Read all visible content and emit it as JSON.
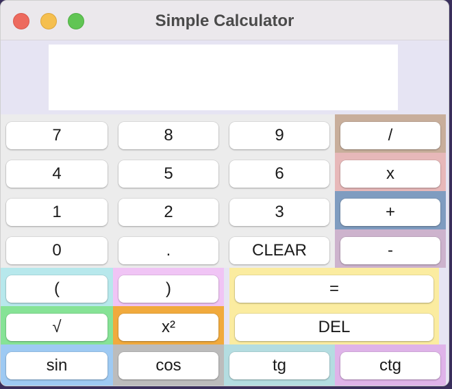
{
  "window": {
    "title": "Simple Calculator"
  },
  "display": {
    "value": ""
  },
  "buttons": {
    "seven": "7",
    "eight": "8",
    "nine": "9",
    "divide": "/",
    "four": "4",
    "five": "5",
    "six": "6",
    "multiply": "x",
    "one": "1",
    "two": "2",
    "three": "3",
    "plus": "+",
    "zero": "0",
    "dot": ".",
    "clear": "CLEAR",
    "minus": "-",
    "lparen": "(",
    "rparen": ")",
    "equals": "=",
    "sqrt": "√",
    "square": "x²",
    "del": "DEL",
    "sin": "sin",
    "cos": "cos",
    "tg": "tg",
    "ctg": "ctg"
  },
  "colors": {
    "grey": "#ececec",
    "divide": "#c8ae9b",
    "multiply": "#e7b8b9",
    "plus": "#7f9cc0",
    "minus": "#cdb3cd",
    "lparen": "#b7e8ec",
    "rparen": "#f0c4f5",
    "equals_del": "#fbeca0",
    "sqrt": "#86e396",
    "square": "#f1aa3d",
    "sin": "#9ecaf3",
    "cos": "#bcbcbc",
    "tg": "#b4dde1",
    "ctg": "#dfb3e9"
  }
}
